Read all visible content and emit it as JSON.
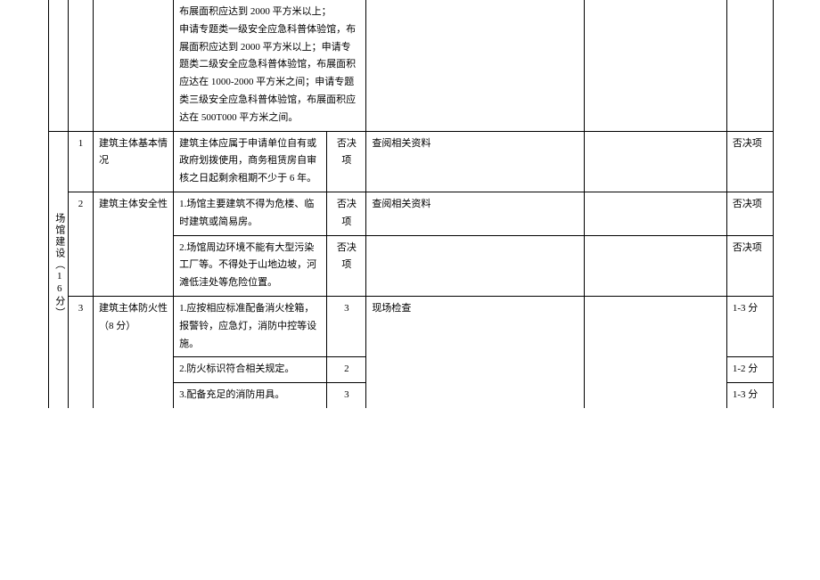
{
  "rows": {
    "r0": {
      "desc": "布展面积应达到 2000 平方米以上；\n申请专题类一级安全应急科普体验馆，布展面积应达到 2000 平方米以上；申请专题类二级安全应急科普体验馆，布展面积应达在 1000-2000 平方米之间；申请专题类三级安全应急科普体验馆，布展面积应达在 500T000 平方米之间。"
    },
    "section": "场馆建设（16分）",
    "r1": {
      "num": "1",
      "name": "建筑主体基本情况",
      "desc": "建筑主体应属于申请单位自有或政府划拨使用，商务租赁房自审核之日起剩余租期不少于 6 年。",
      "score": "否决项",
      "method": "查阅相关资料",
      "note": "否决项"
    },
    "r2a": {
      "num": "2",
      "name": "建筑主体安全性",
      "desc": "1.场馆主要建筑不得为危楼、临时建筑或简易房。",
      "score": "否决项",
      "method": "查阅相关资料",
      "note": "否决项"
    },
    "r2b": {
      "desc": "2.场馆周边环境不能有大型污染工厂等。不得处于山地边坡，河滩低洼处等危险位置。",
      "score": "否决项",
      "note": "否决项"
    },
    "r3a": {
      "num": "3",
      "name": "建筑主体防火性（8 分）",
      "desc": "1.应按相应标准配备消火栓箱，报警铃，应急灯，消防中控等设施。",
      "score": "3",
      "method": "现场检查",
      "note": "1-3 分"
    },
    "r3b": {
      "desc": "2.防火标识符合相关规定。",
      "score": "2",
      "note": "1-2 分"
    },
    "r3c": {
      "desc": "3.配备充足的消防用具。",
      "score": "3",
      "note": "1-3 分"
    }
  }
}
